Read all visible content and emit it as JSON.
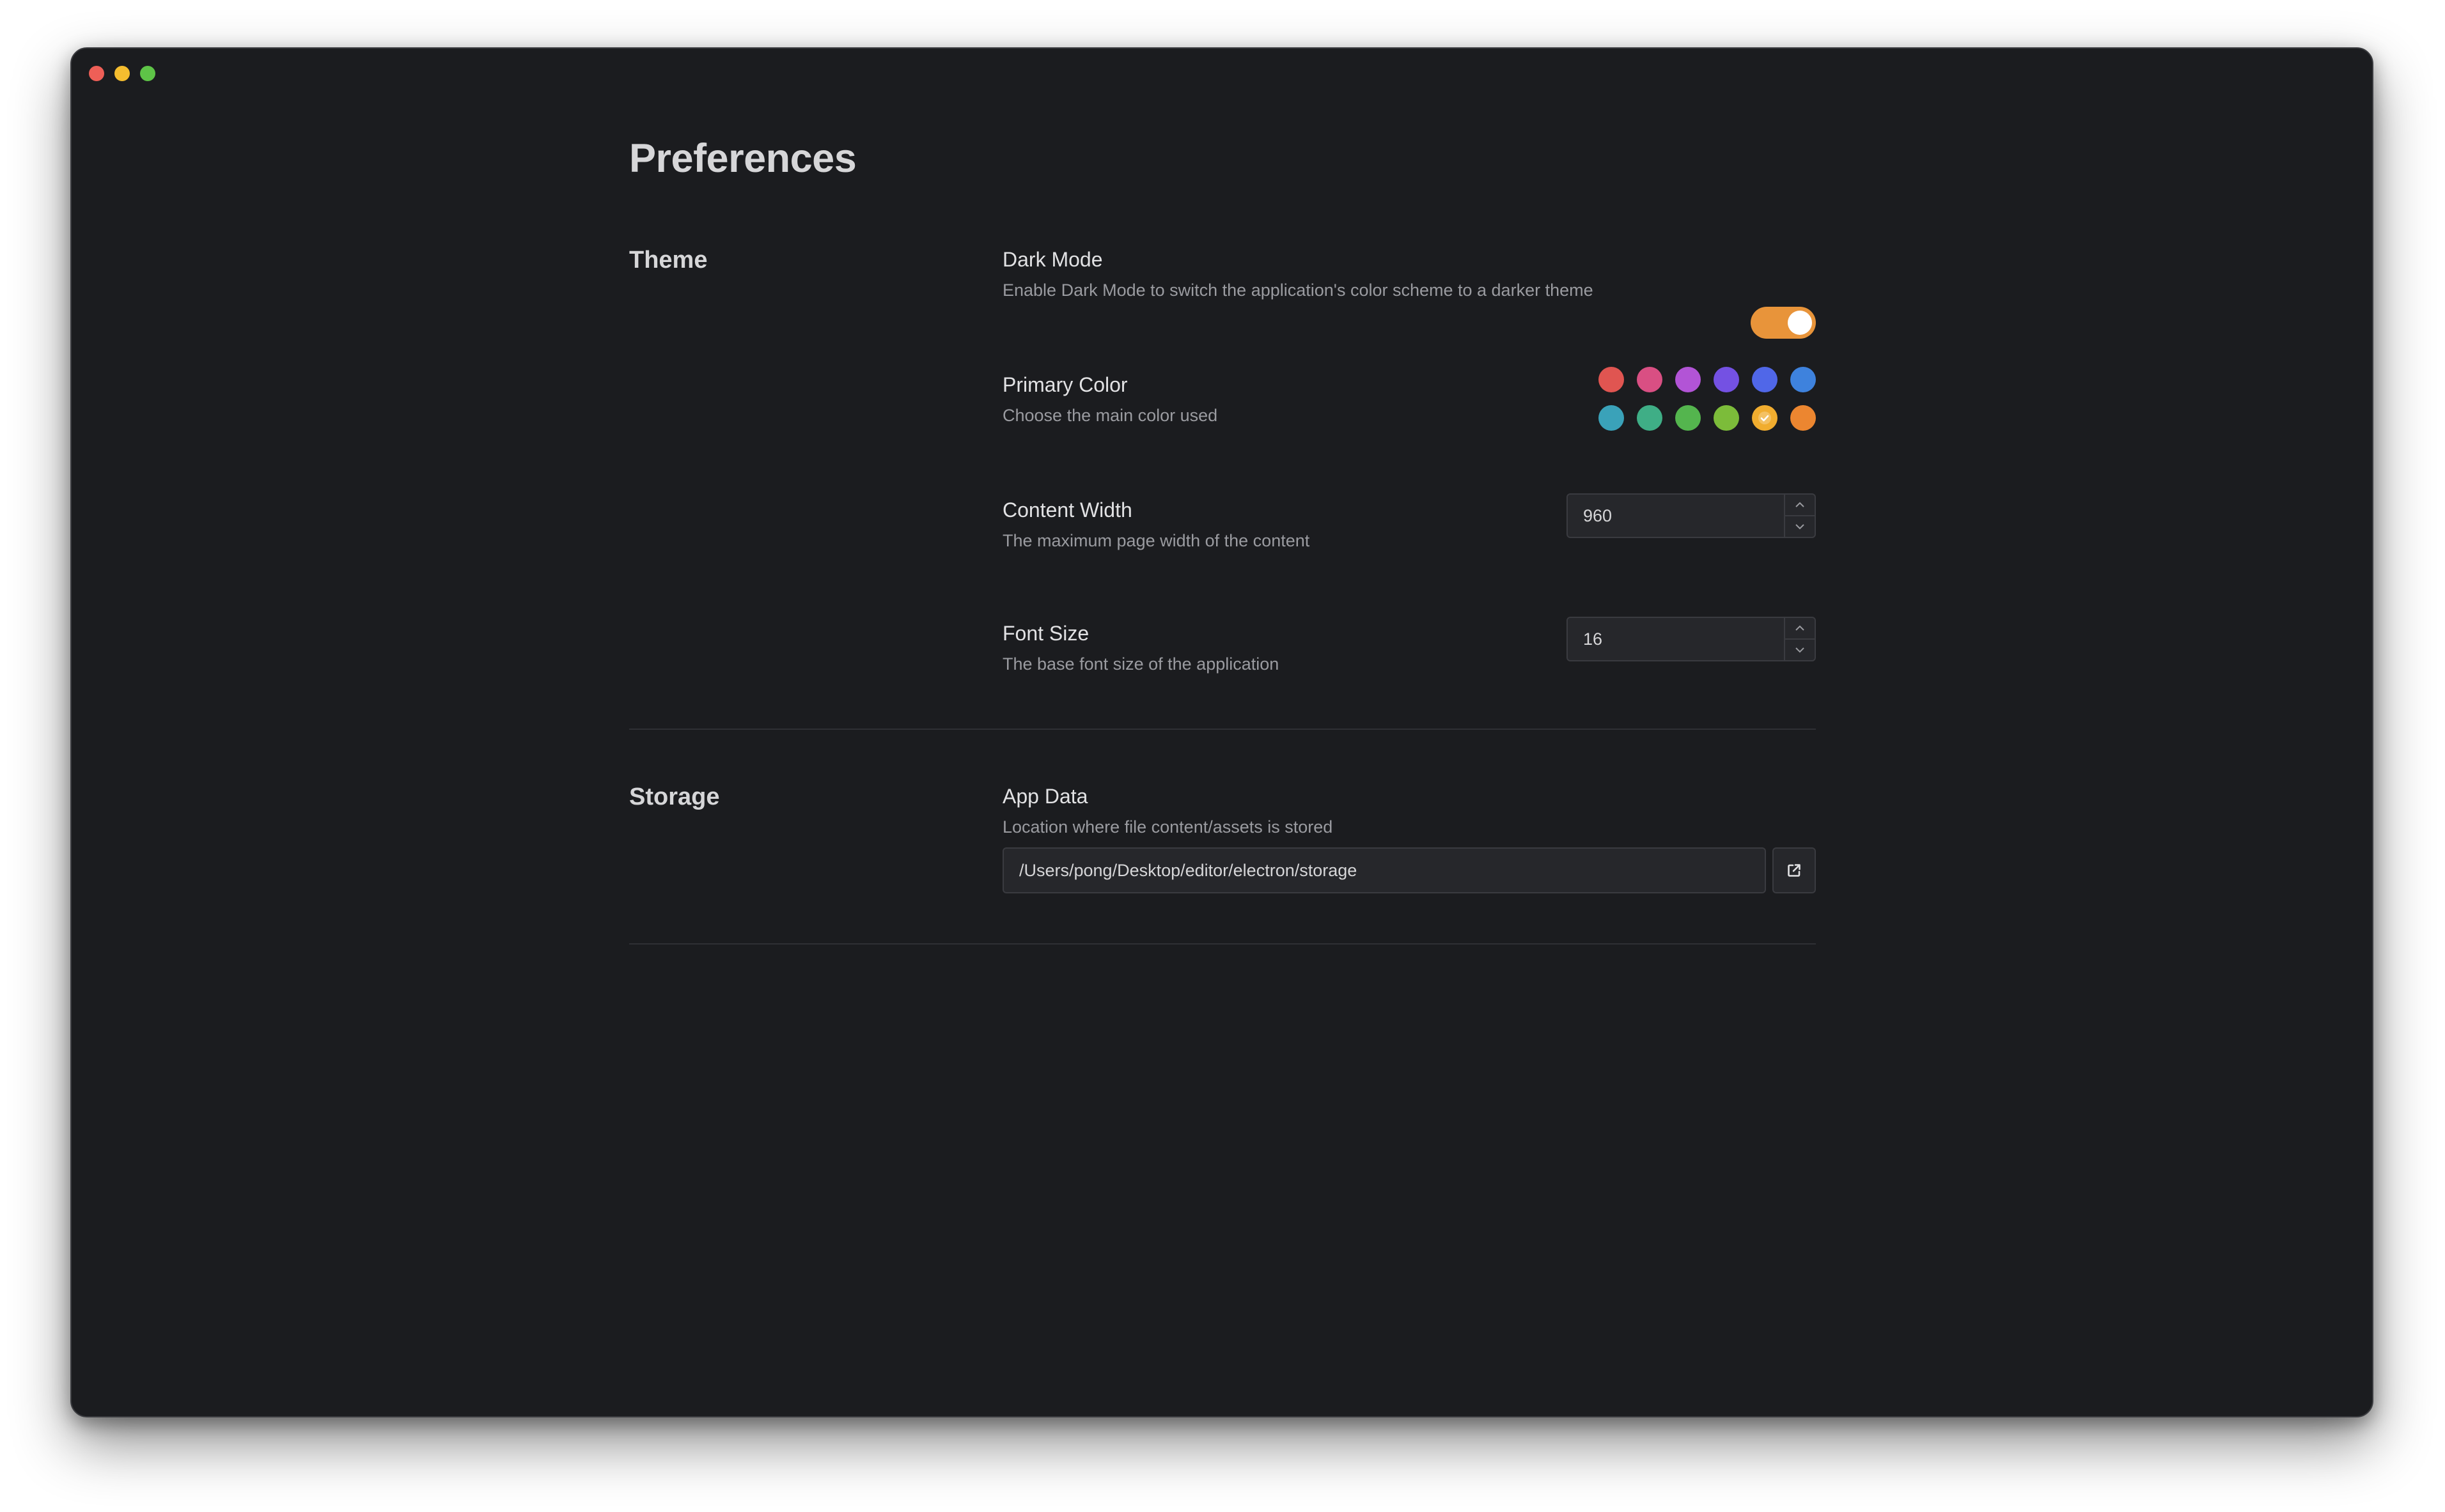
{
  "window": {
    "traffic_lights": [
      {
        "name": "close",
        "color": "#ee5f57"
      },
      {
        "name": "minimize",
        "color": "#f5bd2f"
      },
      {
        "name": "zoom",
        "color": "#5ec447"
      }
    ]
  },
  "page": {
    "title": "Preferences"
  },
  "theme": {
    "title": "Theme",
    "dark_mode": {
      "label": "Dark Mode",
      "description": "Enable Dark Mode to switch the application's color scheme to a darker theme",
      "enabled": true
    },
    "primary_color": {
      "label": "Primary Color",
      "description": "Choose the main color used",
      "selected": "yellow",
      "colors": [
        {
          "name": "red",
          "hex": "#e05551"
        },
        {
          "name": "pink",
          "hex": "#d94f83"
        },
        {
          "name": "purple",
          "hex": "#b254d6"
        },
        {
          "name": "violet",
          "hex": "#7451e3"
        },
        {
          "name": "indigo",
          "hex": "#5067e8"
        },
        {
          "name": "blue",
          "hex": "#3e82dd"
        },
        {
          "name": "cyan",
          "hex": "#3aa2b9"
        },
        {
          "name": "teal",
          "hex": "#3fae86"
        },
        {
          "name": "green",
          "hex": "#54b54e"
        },
        {
          "name": "lime",
          "hex": "#7cbc3a"
        },
        {
          "name": "yellow",
          "hex": "#f1ad2f"
        },
        {
          "name": "orange",
          "hex": "#ec8630"
        }
      ]
    },
    "content_width": {
      "label": "Content Width",
      "description": "The maximum page width of the content",
      "value": "960"
    },
    "font_size": {
      "label": "Font Size",
      "description": "The base font size of the application",
      "value": "16"
    }
  },
  "storage": {
    "title": "Storage",
    "app_data": {
      "label": "App Data",
      "description": "Location where file content/assets is stored",
      "path": "/Users/pong/Desktop/editor/electron/storage"
    }
  },
  "icons": {
    "open_folder": "external-link-icon",
    "stepper_up": "chevron-up-icon",
    "stepper_down": "chevron-down-icon",
    "selected_swatch": "check-icon"
  },
  "colors": {
    "accent": "#e8943a",
    "background": "#1b1c1f"
  }
}
